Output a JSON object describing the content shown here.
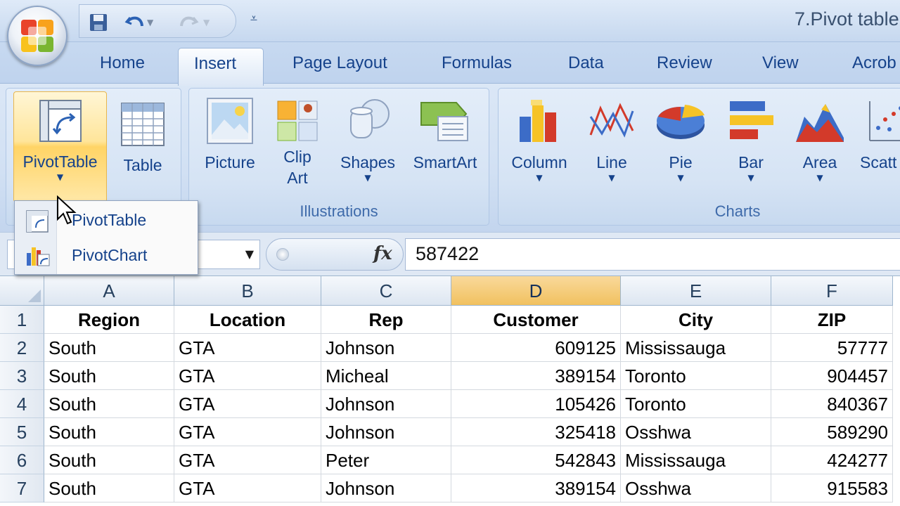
{
  "title_bar": {
    "document_title": "7.Pivot table",
    "quick_access": [
      "save-icon",
      "undo-icon",
      "redo-icon",
      "customize-icon"
    ]
  },
  "tabs": [
    {
      "label": "Home"
    },
    {
      "label": "Insert",
      "active": true
    },
    {
      "label": "Page Layout"
    },
    {
      "label": "Formulas"
    },
    {
      "label": "Data"
    },
    {
      "label": "Review"
    },
    {
      "label": "View"
    },
    {
      "label": "Acrob"
    }
  ],
  "ribbon": {
    "tables_group": {
      "pivottable": "PivotTable",
      "table": "Table"
    },
    "illustrations_group": {
      "label": "Illustrations",
      "picture": "Picture",
      "clip_art_1": "Clip",
      "clip_art_2": "Art",
      "shapes": "Shapes",
      "smartart": "SmartArt"
    },
    "charts_group": {
      "label": "Charts",
      "column": "Column",
      "line": "Line",
      "pie": "Pie",
      "bar": "Bar",
      "area": "Area",
      "scatter": "Scatt"
    }
  },
  "pivot_menu": {
    "items": [
      {
        "label": "PivotTable",
        "icon": "pivottable-icon"
      },
      {
        "label": "PivotChart",
        "icon": "pivotchart-icon"
      }
    ]
  },
  "formula_bar": {
    "name_box": "",
    "fx": "fx",
    "value": "587422"
  },
  "sheet": {
    "columns": [
      "A",
      "B",
      "C",
      "D",
      "E",
      "F"
    ],
    "selected_column": "D",
    "row_numbers": [
      "1",
      "2",
      "3",
      "4",
      "5",
      "6",
      "7"
    ],
    "headers": [
      "Region",
      "Location",
      "Rep",
      "Customer",
      "City",
      "ZIP"
    ],
    "rows": [
      [
        "South",
        "GTA",
        "Johnson",
        "609125",
        "Mississauga",
        "57777"
      ],
      [
        "South",
        "GTA",
        "Micheal",
        "389154",
        "Toronto",
        "904457"
      ],
      [
        "South",
        "GTA",
        "Johnson",
        "105426",
        "Toronto",
        "840367"
      ],
      [
        "South",
        "GTA",
        "Johnson",
        "325418",
        "Osshwa",
        "589290"
      ],
      [
        "South",
        "GTA",
        "Peter",
        "542843",
        "Mississauga",
        "424277"
      ],
      [
        "South",
        "GTA",
        "Johnson",
        "389154",
        "Osshwa",
        "915583"
      ]
    ]
  },
  "colors": {
    "ribbon_blue": "#dbe7f6",
    "tab_text": "#15428b",
    "selected_header": "#f1c15f",
    "pivot_highlight": "#ffd466"
  }
}
